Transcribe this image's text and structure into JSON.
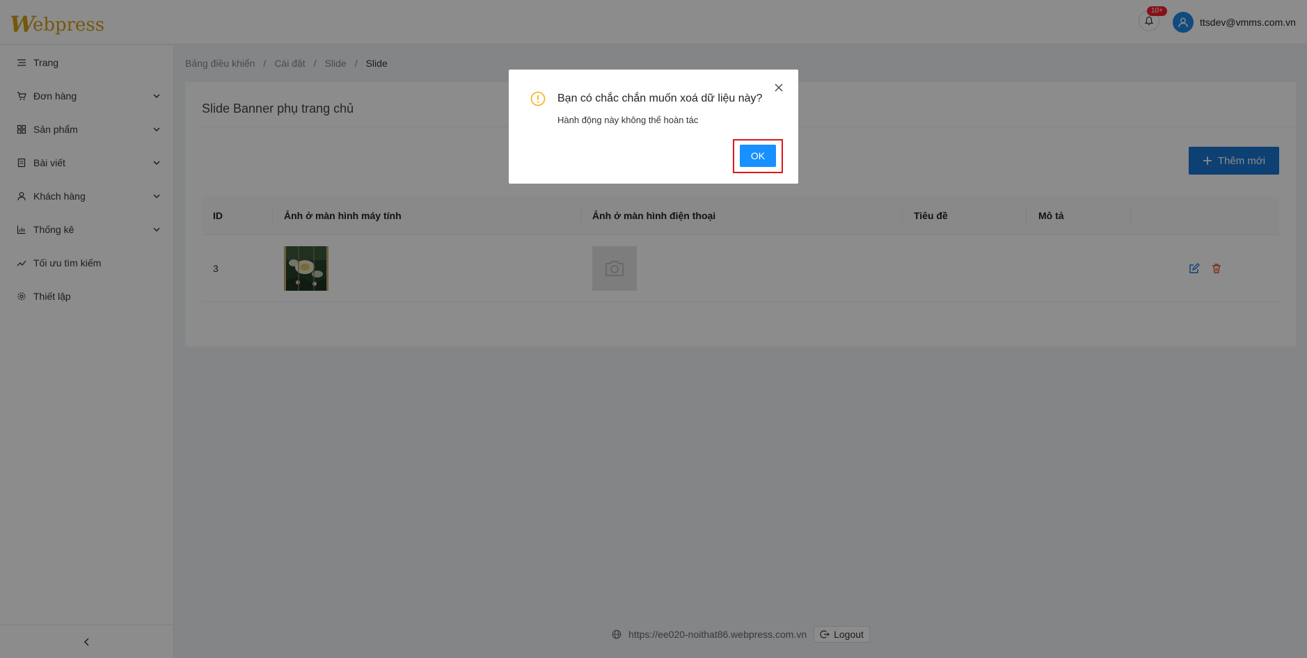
{
  "app": {
    "logo_initial": "W",
    "logo_rest": "ebpress",
    "notification_badge": "10+",
    "user_email": "ttsdev@vmms.com.vn"
  },
  "sidebar": {
    "items": [
      {
        "label": "Trang",
        "icon": "menu-icon",
        "expandable": false
      },
      {
        "label": "Đơn hàng",
        "icon": "cart-icon",
        "expandable": true
      },
      {
        "label": "Sản phẩm",
        "icon": "grid-icon",
        "expandable": true
      },
      {
        "label": "Bài viết",
        "icon": "document-icon",
        "expandable": true
      },
      {
        "label": "Khách hàng",
        "icon": "user-icon",
        "expandable": true
      },
      {
        "label": "Thống kê",
        "icon": "bar-chart-icon",
        "expandable": true
      },
      {
        "label": "Tối ưu tìm kiếm",
        "icon": "trend-icon",
        "expandable": false
      },
      {
        "label": "Thiết lập",
        "icon": "gear-icon",
        "expandable": false
      }
    ]
  },
  "breadcrumb": [
    "Bảng điều khiển",
    "Cài đặt",
    "Slide",
    "Slide"
  ],
  "breadcrumb_sep": "/",
  "page": {
    "title": "Slide Banner phụ trang chủ",
    "add_button": "Thêm mới"
  },
  "table": {
    "columns": [
      "ID",
      "Ảnh ở màn hình máy tính",
      "Ảnh ở màn hình điện thoại",
      "Tiêu đề",
      "Mô tả"
    ],
    "rows": [
      {
        "id": "3",
        "desktop_image": "flower-thumbnail",
        "mobile_image": "camera-placeholder-icon",
        "title": "",
        "description": ""
      }
    ]
  },
  "footer": {
    "url": "https://ee020-noithat86.webpress.com.vn",
    "logout": "Logout"
  },
  "modal": {
    "title": "Bạn có chắc chắn muốn xoá dữ liệu này?",
    "content": "Hành động này không thể hoàn tác",
    "ok_label": "OK"
  },
  "colors": {
    "brand": "#d4a017",
    "primary": "#1976d2",
    "ok_button": "#1890ff",
    "highlight": "#e0141c",
    "warning": "#faad14"
  }
}
